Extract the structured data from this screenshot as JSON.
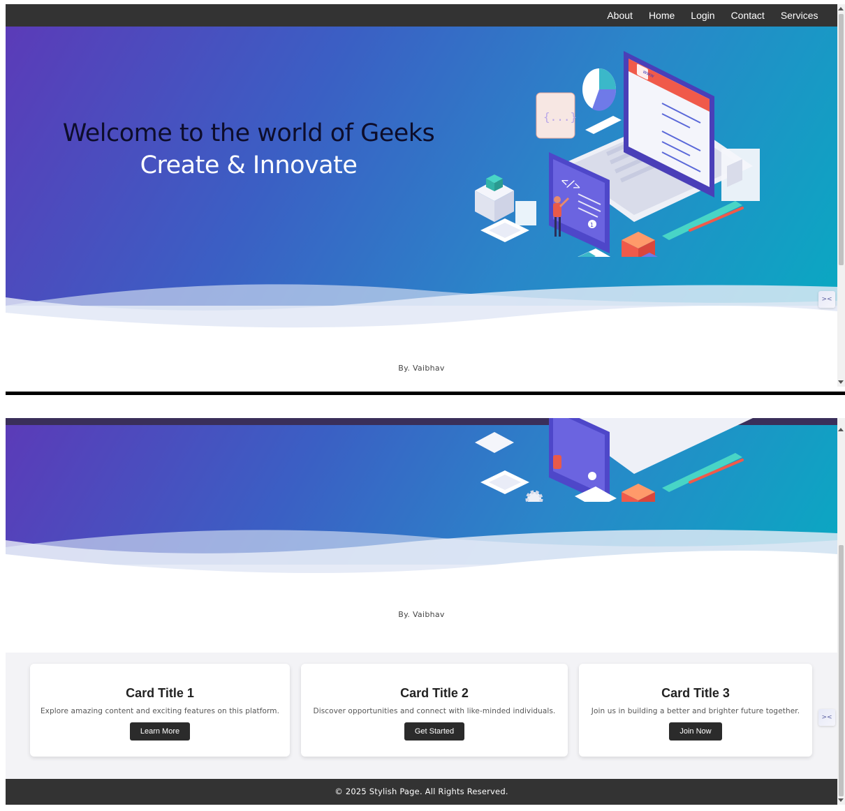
{
  "nav": {
    "links": [
      "About",
      "Home",
      "Login",
      "Contact",
      "Services"
    ]
  },
  "hero": {
    "title": "Welcome to the world of Geeks",
    "subtitle": "Create & Innovate"
  },
  "byline": "By. Vaibhav",
  "cards": [
    {
      "title": "Card Title 1",
      "text": "Explore amazing content and exciting features on this platform.",
      "button": "Learn More"
    },
    {
      "title": "Card Title 2",
      "text": "Discover opportunities and connect with like-minded individuals.",
      "button": "Get Started"
    },
    {
      "title": "Card Title 3",
      "text": "Join us in building a better and brighter future together.",
      "button": "Join Now"
    }
  ],
  "footer": "© 2025 Stylish Page. All Rights Reserved.",
  "widget_icon": "><",
  "illustration": {
    "browser_label": "www",
    "code_glyph": "</>",
    "braces_glyph": "{...}",
    "step_number": "1"
  },
  "colors": {
    "navbar": "#333333",
    "hero_start": "#5b3bb8",
    "hero_end": "#0aa8c2",
    "button": "#2b2b2b"
  }
}
